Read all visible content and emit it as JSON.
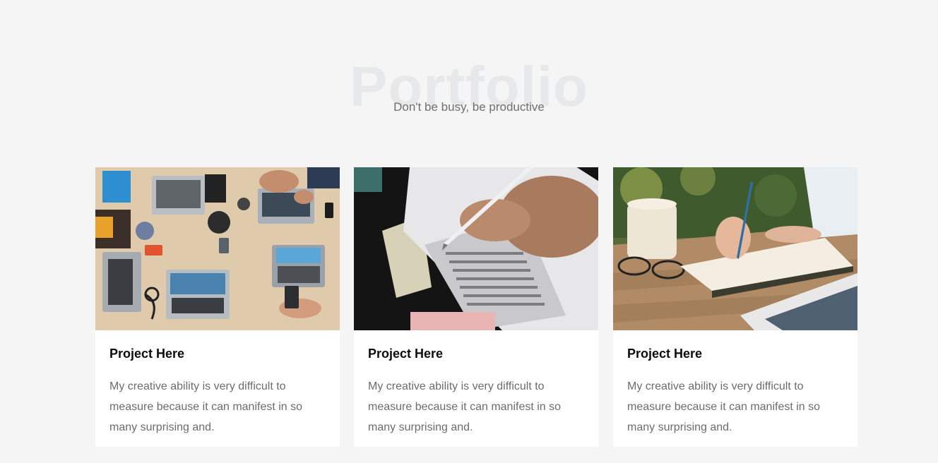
{
  "portfolio": {
    "heading": "Portfolio",
    "subtitle": "Don't be busy, be productive",
    "projects": [
      {
        "title": "Project Here",
        "description": "My creative ability is very difficult to measure because it can manifest in so many surprising and.",
        "image": "team-laptops-desk-photo"
      },
      {
        "title": "Project Here",
        "description": "My creative ability is very difficult to measure because it can manifest in so many surprising and.",
        "image": "hand-filling-answer-sheet-photo"
      },
      {
        "title": "Project Here",
        "description": "My creative ability is very difficult to measure because it can manifest in so many surprising and.",
        "image": "writing-notebook-coffee-photo"
      }
    ]
  },
  "colors": {
    "page_background": "#f5f5f5",
    "card_background": "#ffffff",
    "title_text": "#0c0c0c",
    "body_text": "#6c6c6c",
    "watermark_heading": "#e7e8ea"
  }
}
